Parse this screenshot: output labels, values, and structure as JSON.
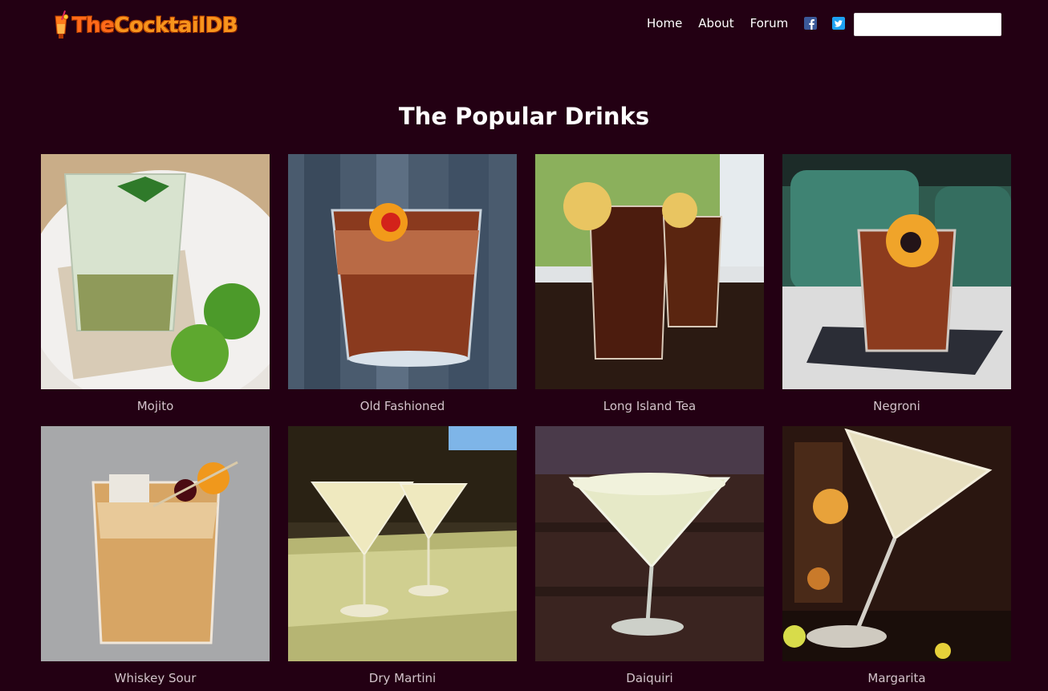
{
  "brand": {
    "prefix": "The",
    "name": "CocktailDB"
  },
  "nav": {
    "items": [
      {
        "label": "Home"
      },
      {
        "label": "About"
      },
      {
        "label": "Forum"
      }
    ],
    "facebook_icon": "facebook-icon",
    "twitter_icon": "twitter-icon"
  },
  "search": {
    "value": "",
    "placeholder": ""
  },
  "section": {
    "title": "The Popular Drinks"
  },
  "drinks": [
    {
      "name": "Mojito"
    },
    {
      "name": "Old Fashioned"
    },
    {
      "name": "Long Island Tea"
    },
    {
      "name": "Negroni"
    },
    {
      "name": "Whiskey Sour"
    },
    {
      "name": "Dry Martini"
    },
    {
      "name": "Daiquiri"
    },
    {
      "name": "Margarita"
    }
  ],
  "colors": {
    "background": "#230013",
    "caption": "#d2c3ca",
    "logo": "#f7941d",
    "facebook": "#3b5998",
    "twitter": "#1da1f2"
  }
}
